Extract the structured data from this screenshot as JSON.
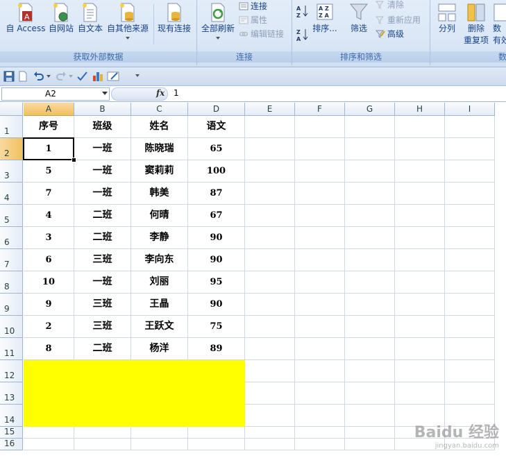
{
  "ribbon": {
    "groups": [
      {
        "title": "获取外部数据"
      },
      {
        "title": "连接"
      },
      {
        "title": "排序和筛选"
      },
      {
        "title": "数"
      }
    ],
    "ext": {
      "access": "自 Access",
      "web": "自网站",
      "text": "自文本",
      "other": "自其他来源",
      "existing": "现有连接"
    },
    "conn": {
      "refresh": "全部刷新",
      "connections": "连接",
      "properties": "属性",
      "edit_links": "编辑链接"
    },
    "sort": {
      "sort": "排序...",
      "filter": "筛选",
      "clear": "清除",
      "reapply": "重新应用",
      "advanced": "高级"
    },
    "tools": {
      "split": "分列",
      "remove_dup_1": "删除",
      "remove_dup_2": "重复项",
      "validation_1": "数",
      "validation_2": "有效"
    }
  },
  "formula_bar": {
    "name_box": "A2",
    "fx": "fx",
    "value": "1"
  },
  "columns": [
    "A",
    "B",
    "C",
    "D",
    "E",
    "F",
    "G",
    "H",
    "I"
  ],
  "rows": [
    "1",
    "2",
    "3",
    "4",
    "5",
    "6",
    "7",
    "8",
    "9",
    "10",
    "11",
    "12",
    "13",
    "14",
    "15",
    "16"
  ],
  "table": {
    "headers": [
      "序号",
      "班级",
      "姓名",
      "语文"
    ],
    "data": [
      [
        "1",
        "一班",
        "陈晓瑞",
        "65"
      ],
      [
        "5",
        "一班",
        "窦莉莉",
        "100"
      ],
      [
        "7",
        "一班",
        "韩美",
        "87"
      ],
      [
        "4",
        "二班",
        "何晴",
        "67"
      ],
      [
        "3",
        "二班",
        "李静",
        "90"
      ],
      [
        "6",
        "三班",
        "李向东",
        "90"
      ],
      [
        "10",
        "一班",
        "刘丽",
        "95"
      ],
      [
        "9",
        "三班",
        "王晶",
        "90"
      ],
      [
        "2",
        "三班",
        "王跃文",
        "75"
      ],
      [
        "8",
        "二班",
        "杨洋",
        "89"
      ]
    ]
  },
  "fill_color": "#ffff00",
  "watermark": {
    "brand": "Baidu 经验",
    "url": "jingyan.baidu.com"
  }
}
